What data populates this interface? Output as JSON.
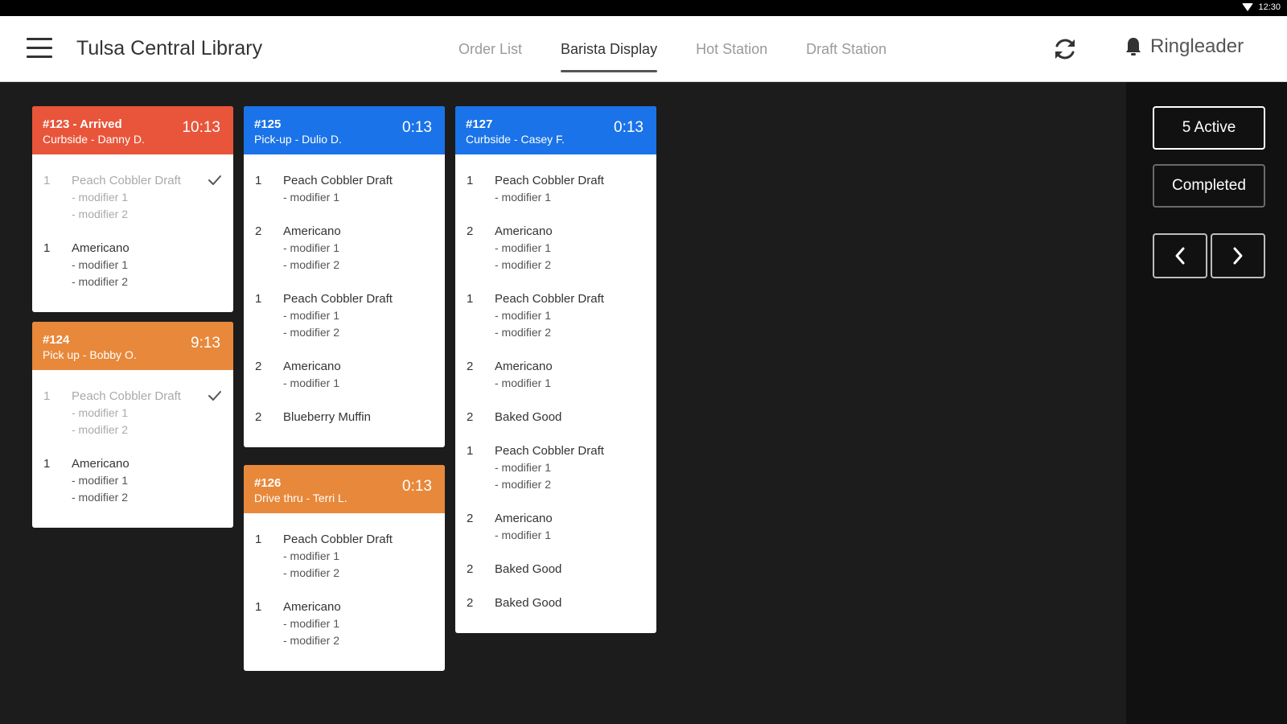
{
  "statusbar": {
    "time": "12:30"
  },
  "header": {
    "title": "Tulsa Central Library",
    "tabs": [
      {
        "label": "Order List",
        "active": false
      },
      {
        "label": "Barista Display",
        "active": true
      },
      {
        "label": "Hot Station",
        "active": false
      },
      {
        "label": "Draft Station",
        "active": false
      }
    ],
    "user": "Ringleader"
  },
  "sidebar": {
    "active_button": "5 Active",
    "completed_button": "Completed"
  },
  "colors": {
    "arrived": "#e8553a",
    "pickup": "#1a73e8",
    "waiting": "#e8883a"
  },
  "tickets": [
    {
      "id": "#123 - Arrived",
      "subtitle": "Curbside - Danny D.",
      "time": "10:13",
      "color": "red",
      "items": [
        {
          "qty": "1",
          "name": "Peach Cobbler Draft",
          "modifiers": [
            "- modifier 1",
            "- modifier 2"
          ],
          "done": true
        },
        {
          "qty": "1",
          "name": "Americano",
          "modifiers": [
            "- modifier 1",
            "- modifier 2"
          ],
          "done": false
        }
      ]
    },
    {
      "id": "#124",
      "subtitle": "Pick up - Bobby O.",
      "time": "9:13",
      "color": "orange",
      "items": [
        {
          "qty": "1",
          "name": "Peach Cobbler Draft",
          "modifiers": [
            "- modifier 1",
            "- modifier 2"
          ],
          "done": true
        },
        {
          "qty": "1",
          "name": "Americano",
          "modifiers": [
            "- modifier 1",
            "- modifier 2"
          ],
          "done": false
        }
      ]
    },
    {
      "id": "#125",
      "subtitle": "Pick-up - Dulio D.",
      "time": "0:13",
      "color": "blue",
      "items": [
        {
          "qty": "1",
          "name": "Peach Cobbler Draft",
          "modifiers": [
            "- modifier 1"
          ],
          "done": false
        },
        {
          "qty": "2",
          "name": "Americano",
          "modifiers": [
            "- modifier 1",
            "- modifier 2"
          ],
          "done": false
        },
        {
          "qty": "1",
          "name": "Peach Cobbler Draft",
          "modifiers": [
            "- modifier 1",
            "- modifier 2"
          ],
          "done": false
        },
        {
          "qty": "2",
          "name": "Americano",
          "modifiers": [
            "- modifier 1"
          ],
          "done": false
        },
        {
          "qty": "2",
          "name": "Blueberry Muffin",
          "modifiers": [],
          "done": false
        }
      ]
    },
    {
      "id": "#126",
      "subtitle": "Drive thru - Terri L.",
      "time": "0:13",
      "color": "orange",
      "items": [
        {
          "qty": "1",
          "name": "Peach Cobbler Draft",
          "modifiers": [
            "- modifier 1",
            "- modifier 2"
          ],
          "done": false
        },
        {
          "qty": "1",
          "name": "Americano",
          "modifiers": [
            "- modifier 1",
            "- modifier 2"
          ],
          "done": false
        }
      ]
    },
    {
      "id": "#127",
      "subtitle": "Curbside - Casey F.",
      "time": "0:13",
      "color": "blue",
      "items": [
        {
          "qty": "1",
          "name": "Peach Cobbler Draft",
          "modifiers": [
            "- modifier 1"
          ],
          "done": false
        },
        {
          "qty": "2",
          "name": "Americano",
          "modifiers": [
            "- modifier 1",
            "- modifier 2"
          ],
          "done": false
        },
        {
          "qty": "1",
          "name": "Peach Cobbler Draft",
          "modifiers": [
            "- modifier 1",
            "- modifier 2"
          ],
          "done": false
        },
        {
          "qty": "2",
          "name": "Americano",
          "modifiers": [
            "- modifier 1"
          ],
          "done": false
        },
        {
          "qty": "2",
          "name": "Baked Good",
          "modifiers": [],
          "done": false
        },
        {
          "qty": "1",
          "name": "Peach Cobbler Draft",
          "modifiers": [
            "- modifier 1",
            "- modifier 2"
          ],
          "done": false
        },
        {
          "qty": "2",
          "name": "Americano",
          "modifiers": [
            "- modifier 1"
          ],
          "done": false
        },
        {
          "qty": "2",
          "name": "Baked Good",
          "modifiers": [],
          "done": false
        },
        {
          "qty": "2",
          "name": "Baked Good",
          "modifiers": [],
          "done": false
        }
      ]
    }
  ]
}
